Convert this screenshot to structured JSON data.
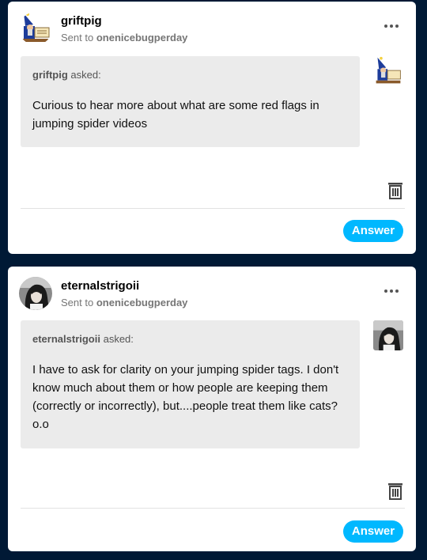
{
  "asks": [
    {
      "username": "griftpig",
      "sent_prefix": "Sent to",
      "recipient": "onenicebugperday",
      "asker": "griftpig",
      "asked_suffix": "asked:",
      "question": "Curious to hear more about what are some red flags in jumping spider videos",
      "answer_label": "Answer",
      "avatar_icon": "wizard-avatar-icon"
    },
    {
      "username": "eternalstrigoii",
      "sent_prefix": "Sent to",
      "recipient": "onenicebugperday",
      "asker": "eternalstrigoii",
      "asked_suffix": "asked:",
      "question": "I have to ask for clarity on your jumping spider tags. I don't know much about them or how people are keeping them (correctly or incorrectly), but....people treat them like cats? o.o",
      "answer_label": "Answer",
      "avatar_icon": "portrait-avatar-icon"
    }
  ],
  "colors": {
    "background": "#001935",
    "card": "#ffffff",
    "bubble": "#ebebeb",
    "accent": "#00b8ff"
  }
}
